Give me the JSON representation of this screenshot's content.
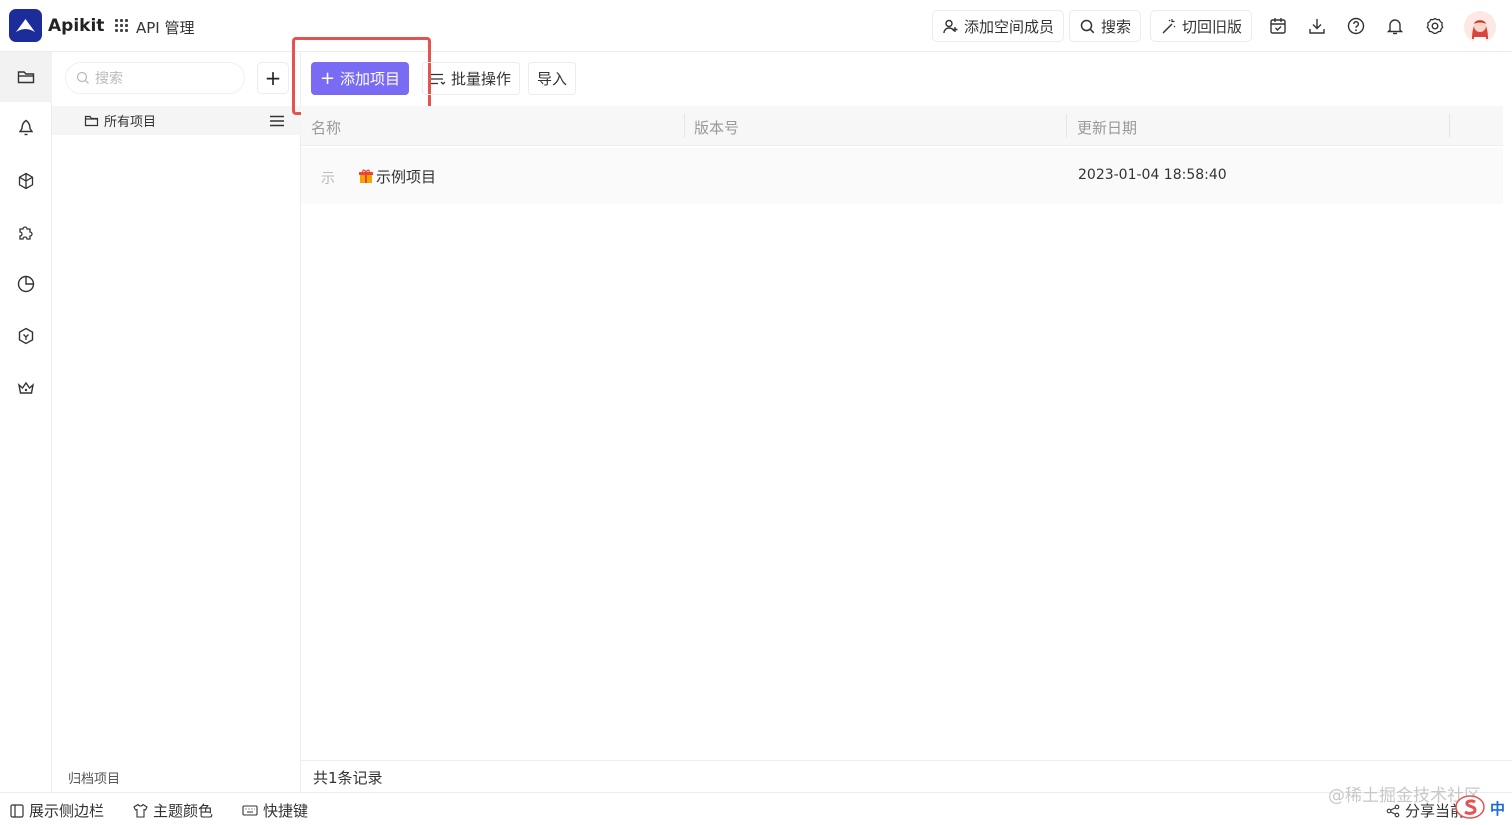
{
  "header": {
    "app_name": "Apikit",
    "module": "API 管理",
    "add_member": "添加空间成员",
    "search": "搜索",
    "switch_old": "切回旧版"
  },
  "tree": {
    "search_placeholder": "搜索",
    "add_symbol": "+",
    "all_projects": "所有项目",
    "archive": "归档项目"
  },
  "toolbar": {
    "add_project": "添加项目",
    "batch": "批量操作",
    "import": "导入"
  },
  "table": {
    "columns": [
      "名称",
      "版本号",
      "更新日期"
    ],
    "rows": [
      {
        "icon_text": "示",
        "name": "示例项目",
        "version": "",
        "updated": "2023-01-04 18:58:40"
      }
    ],
    "count": "共1条记录"
  },
  "footer": {
    "show_sidebar": "展示侧边栏",
    "theme": "主题颜色",
    "shortcuts": "快捷键",
    "share": "分享当前",
    "watermark": "@稀土掘金技术社区",
    "ime_lang": "中"
  },
  "colors": {
    "brand": "#1c2c9a",
    "primary": "#7a6bf5",
    "highlight": "#e5524f"
  }
}
